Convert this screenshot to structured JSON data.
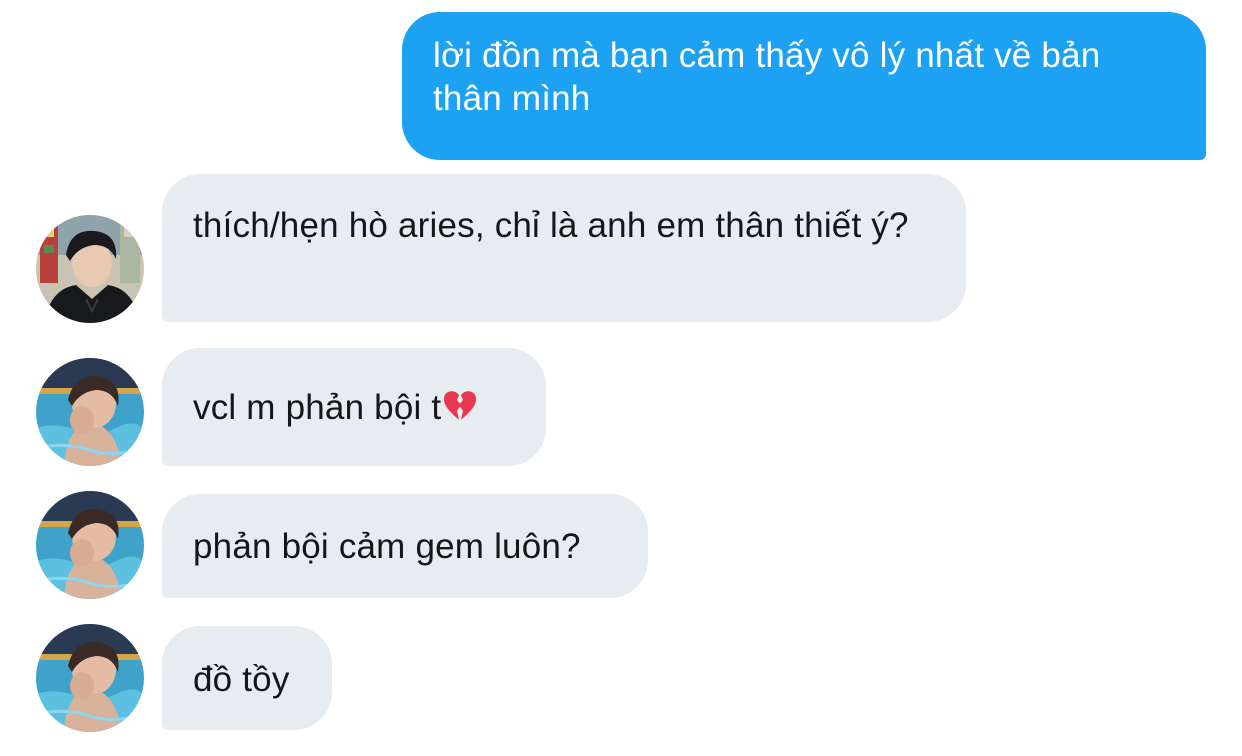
{
  "conversation": {
    "messages": [
      {
        "sender": "me",
        "text": "lời đồn mà bạn cảm thấy vô lý nhất về bản thân mình"
      },
      {
        "sender": "user-a",
        "avatar": "avatar-hoodie-portrait",
        "text": "thích/hẹn hò aries, chỉ là anh em thân thiết ý?"
      },
      {
        "sender": "user-b",
        "avatar": "avatar-pool-portrait",
        "text": "vcl m phản bội t",
        "emoji": "broken-heart-icon"
      },
      {
        "sender": "user-b",
        "avatar": "avatar-pool-portrait",
        "text": "phản bội cảm gem luôn?"
      },
      {
        "sender": "user-b",
        "avatar": "avatar-pool-portrait",
        "text": "đồ tồy"
      }
    ]
  },
  "colors": {
    "outgoing_bubble": "#1da1f2",
    "incoming_bubble": "#e6ecf0",
    "outgoing_text": "#ffffff",
    "incoming_text": "#14171a",
    "broken_heart": "#e8384f"
  }
}
